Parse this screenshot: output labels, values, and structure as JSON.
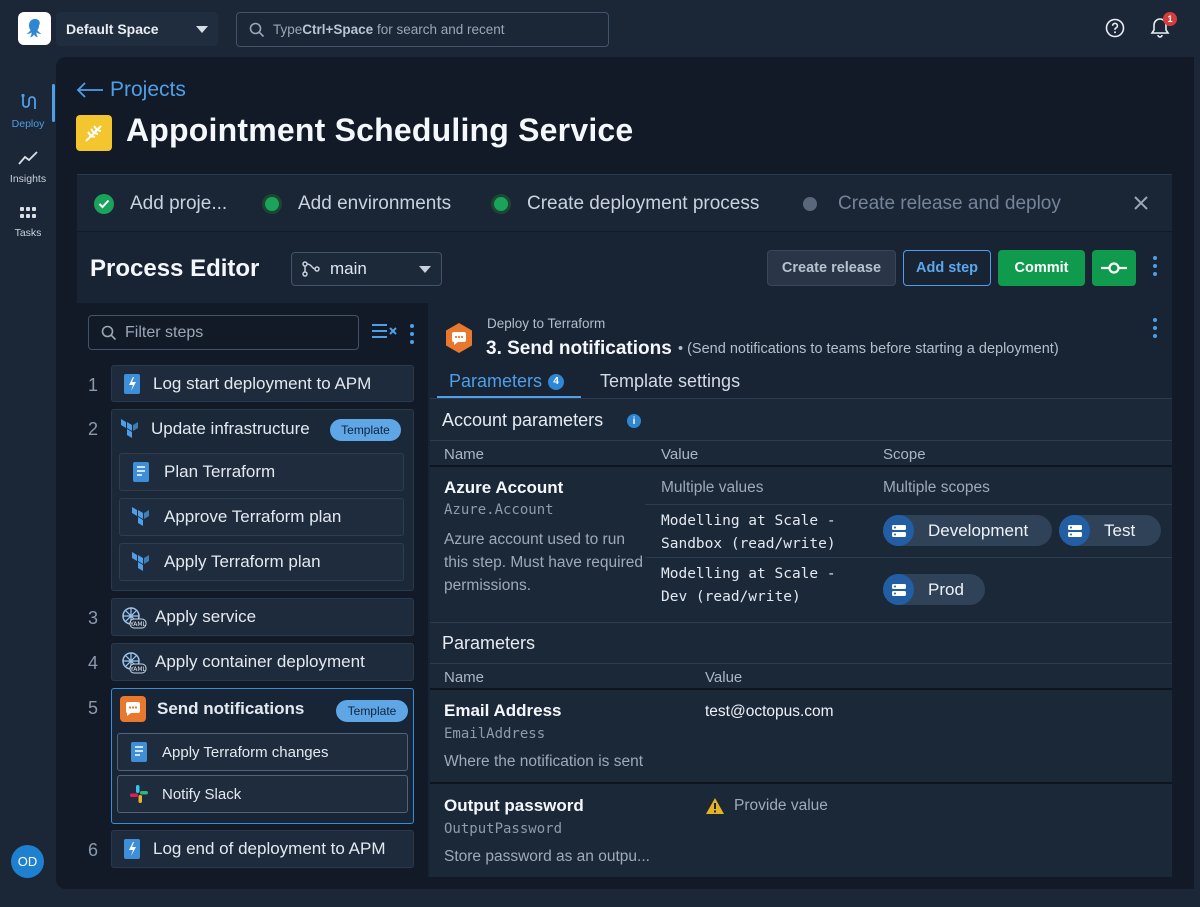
{
  "topbar": {
    "space": "Default Space",
    "search_prefix": "Type ",
    "search_key": "Ctrl+Space",
    "search_suffix": " for search and recent",
    "notification_count": "1"
  },
  "nav": {
    "items": [
      {
        "label": "Deploy",
        "icon": "deploy-icon"
      },
      {
        "label": "Insights",
        "icon": "insights-icon"
      },
      {
        "label": "Tasks",
        "icon": "tasks-icon"
      }
    ],
    "avatar_initials": "OD"
  },
  "page": {
    "back_label": "Projects",
    "title": "Appointment Scheduling Service"
  },
  "wizard": {
    "steps": [
      {
        "label": "Add proje...",
        "state": "done"
      },
      {
        "label": "Add environments",
        "state": "active"
      },
      {
        "label": "Create deployment process",
        "state": "active"
      },
      {
        "label": "Create release and deploy",
        "state": "pending"
      }
    ]
  },
  "editor": {
    "title": "Process Editor",
    "branch": "main",
    "buttons": {
      "create_release": "Create release",
      "add_step": "Add step",
      "commit": "Commit"
    },
    "filter_placeholder": "Filter steps"
  },
  "steps": [
    {
      "num": "1",
      "label": "Log start deployment to APM"
    },
    {
      "num": "2",
      "label": "Update infrastructure",
      "badge": "Template",
      "children": [
        "Plan Terraform",
        "Approve Terraform plan",
        "Apply Terraform plan"
      ]
    },
    {
      "num": "3",
      "label": "Apply service"
    },
    {
      "num": "4",
      "label": "Apply container deployment"
    },
    {
      "num": "5",
      "label": "Send notifications",
      "badge": "Template",
      "children": [
        "Apply Terraform changes",
        "Notify Slack"
      ]
    },
    {
      "num": "6",
      "label": "Log end of deployment to APM"
    }
  ],
  "detail": {
    "kicker": "Deploy to Terraform",
    "title": "3. Send notifications",
    "description": "• (Send notifications to teams before starting a deployment)",
    "tabs": [
      {
        "label": "Parameters",
        "count": "4"
      },
      {
        "label": "Template settings"
      }
    ],
    "account_section": {
      "title": "Account parameters",
      "info": "i",
      "columns": [
        "Name",
        "Value",
        "Scope"
      ],
      "param": {
        "name": "Azure Account",
        "variable": "Azure.Account",
        "help": "Azure account used to run this step. Must have required permissions.",
        "value_summary": "Multiple values",
        "scope_summary": "Multiple scopes",
        "rows": [
          {
            "value_line1": "Modelling at Scale -",
            "value_line2": "Sandbox (read/write)",
            "scopes": [
              "Development",
              "Test"
            ]
          },
          {
            "value_line1": "Modelling at Scale -",
            "value_line2": "Dev (read/write)",
            "scopes": [
              "Prod"
            ]
          }
        ]
      }
    },
    "params_section": {
      "title": "Parameters",
      "columns": [
        "Name",
        "Value"
      ],
      "params": [
        {
          "name": "Email Address",
          "variable": "EmailAddress",
          "help": "Where the notification is sent",
          "value": "test@octopus.com"
        },
        {
          "name": "Output password",
          "variable": "OutputPassword",
          "help": "Store password as an outpu...",
          "value": "Provide value"
        }
      ]
    }
  },
  "colors": {
    "accent": "#4e9fe8",
    "commit": "#0f9a4e",
    "project_icon": "#f3c52e",
    "template_badge": "#5ea6e6",
    "warning": "#e7b325"
  }
}
